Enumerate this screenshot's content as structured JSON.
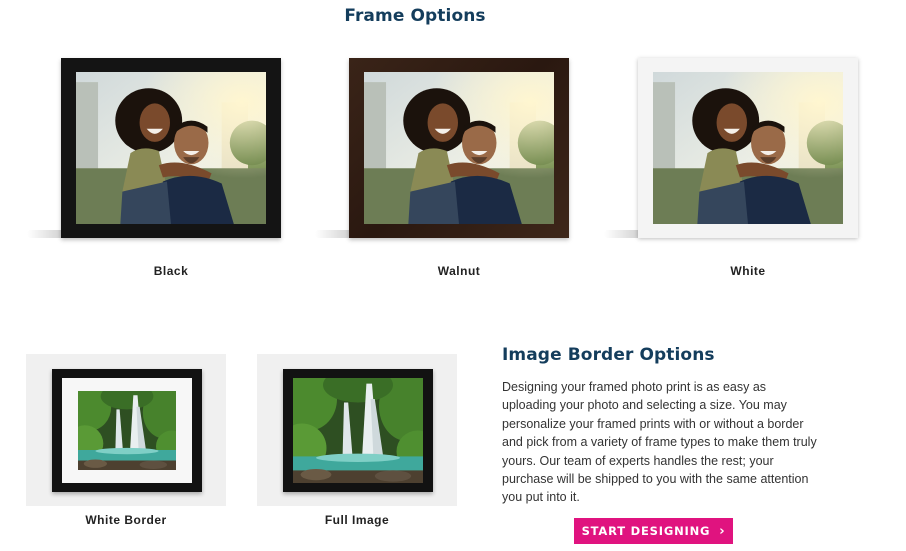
{
  "frame_section": {
    "title": "Frame Options",
    "options": [
      {
        "label": "Black"
      },
      {
        "label": "Walnut"
      },
      {
        "label": "White"
      }
    ]
  },
  "border_section": {
    "title": "Image Border Options",
    "description": "Designing your framed photo print is as easy as uploading your photo and selecting a size. You may personalize your framed prints with or without a border and pick from a variety of frame types to make them truly yours. Our team of experts handles the rest; your purchase will be shipped to you with the same attention you put into it.",
    "options": [
      {
        "label": "White Border"
      },
      {
        "label": "Full Image"
      }
    ],
    "cta_label": "START DESIGNING",
    "cta_icon": "chevron-right-icon"
  },
  "colors": {
    "heading": "#143d5c",
    "cta": "#e0137f"
  }
}
